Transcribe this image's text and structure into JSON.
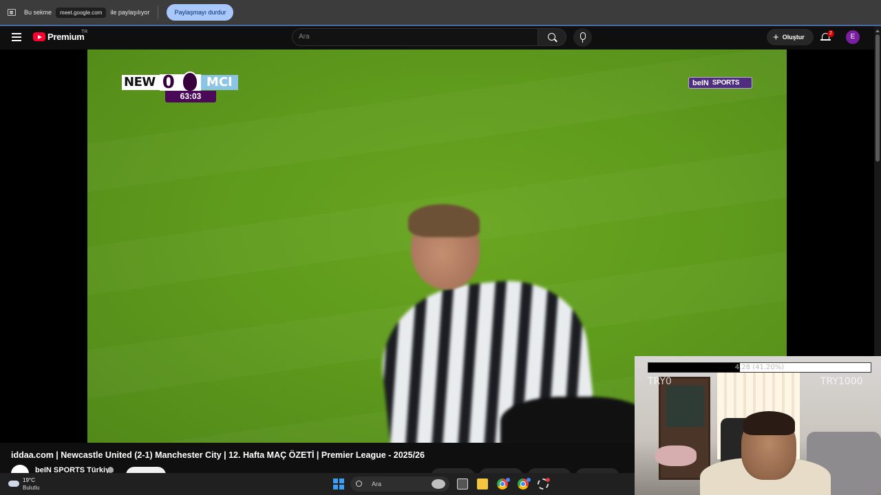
{
  "share_bar": {
    "prefix": "Bu sekme",
    "domain": "meet.google.com",
    "suffix": "ile paylaşılıyor",
    "stop_label": "Paylaşmayı durdur"
  },
  "youtube": {
    "logo_text": "Premium",
    "country_code": "TR",
    "search_placeholder": "Ara",
    "create_label": "Oluştur",
    "notification_count": "2",
    "avatar_letter": "E"
  },
  "video": {
    "home_team": "NEW",
    "home_score": "0",
    "away_score": "0",
    "away_team": "MCI",
    "match_clock": "63:03",
    "broadcaster_main": "beIN",
    "broadcaster_sub": "SPORTS",
    "title": "iddaa.com | Newcastle United (2-1) Manchester City | 12. Hafta MAÇ ÖZETİ | Premier League - 2025/26",
    "channel_name": "beIN SPORTS Türkiye"
  },
  "webcam_overlay": {
    "progress_label": "4.28 (41.20%)",
    "progress_fraction": 0.412,
    "left_label": "TRY0",
    "right_label": "TRY1000"
  },
  "taskbar": {
    "temperature": "19°C",
    "condition": "Bulutlu",
    "search_label": "Ara"
  },
  "colors": {
    "share_button": "#a8c7fa",
    "youtube_red": "#ff0033",
    "pitch_green": "#5f9b1c",
    "premier_league_purple": "#37003c",
    "avatar_purple": "#7b1fa2"
  },
  "icons": [
    "tab-share-icon",
    "menu-icon",
    "youtube-logo-icon",
    "search-icon",
    "microphone-icon",
    "plus-icon",
    "bell-icon",
    "verified-icon",
    "windows-start-icon",
    "weather-cloud-icon",
    "task-view-icon",
    "file-explorer-icon",
    "chrome-icon",
    "settings-icon"
  ]
}
